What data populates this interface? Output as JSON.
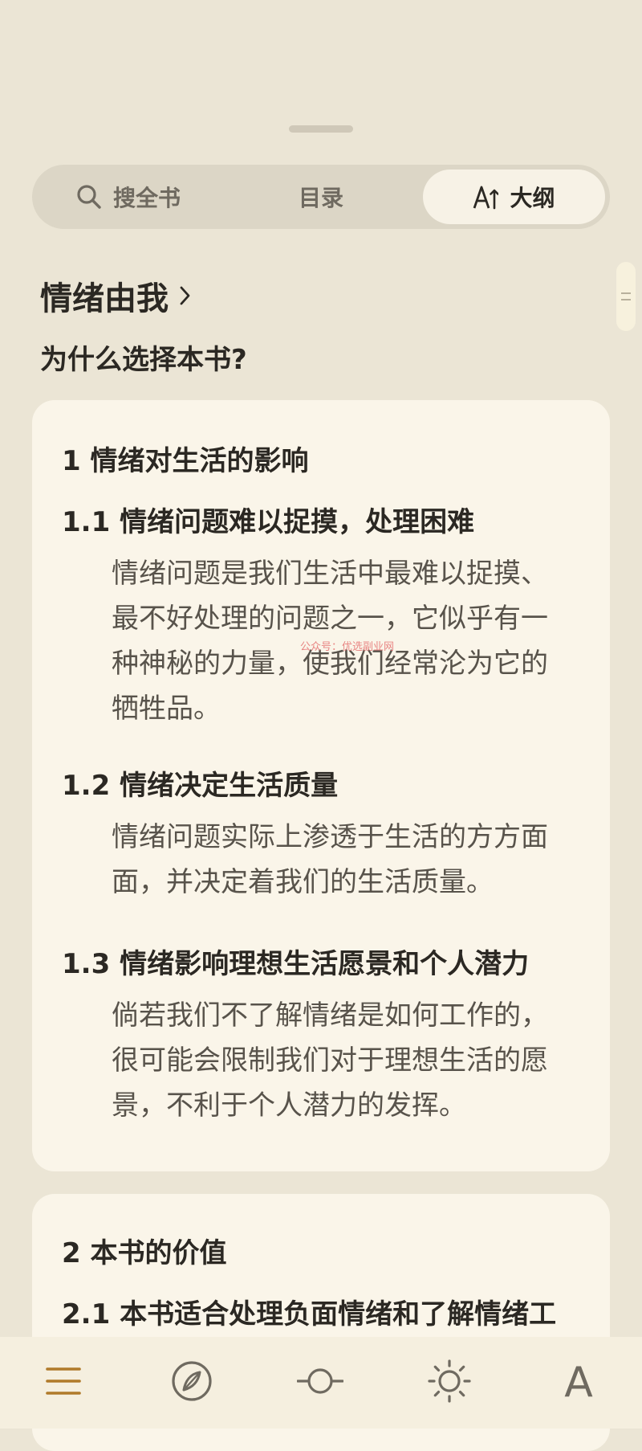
{
  "tabs": {
    "search_label": "搜全书",
    "toc_label": "目录",
    "outline_label": "大纲",
    "active": "outline"
  },
  "book": {
    "title": "情绪由我",
    "intro_heading": "为什么选择本书?"
  },
  "sections": [
    {
      "heading": "1 情绪对生活的影响",
      "subsections": [
        {
          "heading": "1.1 情绪问题难以捉摸，处理困难",
          "text": "情绪问题是我们生活中最难以捉摸、最不好处理的问题之一，它似乎有一种神秘的力量，使我们经常沦为它的牺牲品。"
        },
        {
          "heading": "1.2 情绪决定生活质量",
          "text": "情绪问题实际上渗透于生活的方方面面，并决定着我们的生活质量。"
        },
        {
          "heading": "1.3 情绪影响理想生活愿景和个人潜力",
          "text": "倘若我们不了解情绪是如何工作的，很可能会限制我们对于理想生活的愿景，不利于个人潜力的发挥。"
        }
      ]
    },
    {
      "heading": "2 本书的价值",
      "subsections": [
        {
          "heading": "2.1 本书适合处理负面情绪和了解情绪工"
        }
      ]
    }
  ],
  "watermark": "公众号：优选副业网",
  "bottom_nav": {
    "items": [
      "menu-icon",
      "compass-icon",
      "slider-icon",
      "brightness-icon",
      "font-icon"
    ],
    "font_label": "A"
  },
  "colors": {
    "background": "#ebe5d5",
    "card": "#faf5e9",
    "tab_track": "#dcd6c6",
    "active_tab": "#f7f2e6",
    "accent": "#b07a2a",
    "body_text": "#58534b",
    "heading_text": "#2b2823"
  }
}
